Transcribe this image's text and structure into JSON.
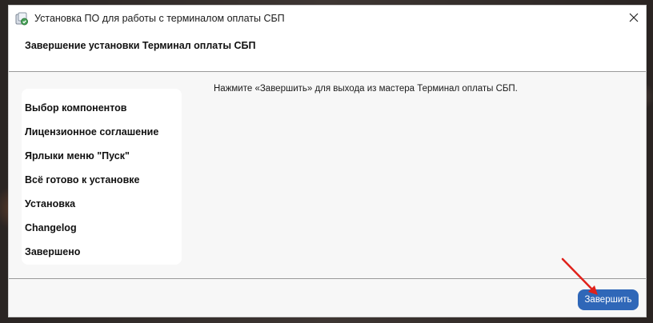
{
  "window": {
    "title": "Установка ПО для работы с терминалом оплаты СБП"
  },
  "header": {
    "title": "Завершение установки Терминал оплаты СБП"
  },
  "sidebar": {
    "steps": [
      {
        "label": "Выбор компонентов"
      },
      {
        "label": "Лицензионное соглашение"
      },
      {
        "label": "Ярлыки меню \"Пуск\""
      },
      {
        "label": "Всё готово к установке"
      },
      {
        "label": "Установка"
      },
      {
        "label": "Changelog"
      },
      {
        "label": "Завершено"
      }
    ]
  },
  "content": {
    "message": "Нажмите «Завершить» для выхода из мастера Терминал оплаты СБП."
  },
  "footer": {
    "finish_label": "Завершить"
  },
  "colors": {
    "accent": "#2f67b8",
    "annotation": "#e0221b"
  },
  "icons": {
    "app": "installer-icon",
    "close": "close-icon",
    "annotation": "arrow-icon"
  }
}
